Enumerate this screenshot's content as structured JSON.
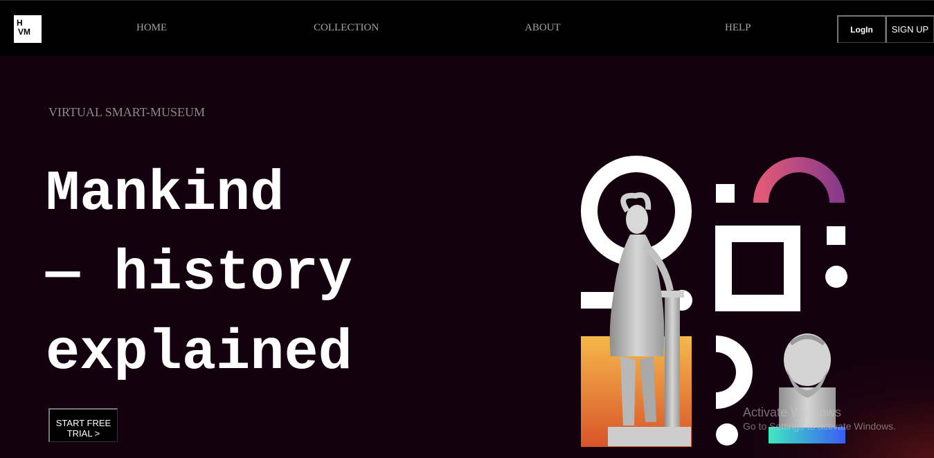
{
  "nav": {
    "logo_line1": "H",
    "logo_line2": "VM",
    "links": [
      "HOME",
      "COLLECTION",
      "ABOUT",
      "HELP"
    ],
    "login_label": "LogIn",
    "signup_label": "SIGN UP"
  },
  "hero": {
    "tagline": "VIRTUAL SMART-MUSEUM",
    "headline_lines": [
      "Mankind",
      "— history",
      "explained"
    ],
    "cta_line1": "START FREE",
    "cta_line2": "TRIAL >"
  },
  "watermark": {
    "title": "Activate Windows",
    "subtitle": "Go to Settings to activate Windows."
  },
  "colors": {
    "background": "#14010f",
    "nav_bg": "#000000",
    "arc_gradient_start": "#e05a78",
    "arc_gradient_end": "#8a3a8a",
    "panel_gradient_top": "#f6b84a",
    "panel_gradient_bottom": "#d8542a",
    "bar_gradient_start": "#3ee8c0",
    "bar_gradient_end": "#3a5cf2"
  }
}
